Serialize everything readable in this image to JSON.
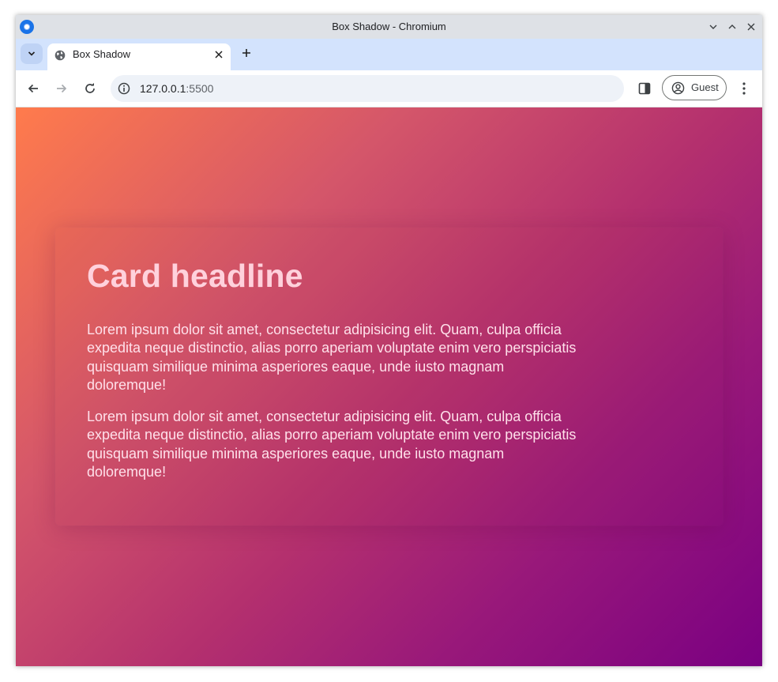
{
  "window": {
    "title": "Box Shadow - Chromium"
  },
  "tabs": [
    {
      "title": "Box Shadow",
      "active": true
    }
  ],
  "toolbar": {
    "url_host": "127.0.0.1",
    "url_port": ":5500",
    "profile_label": "Guest"
  },
  "page": {
    "card": {
      "headline": "Card headline",
      "paragraphs": [
        "Lorem ipsum dolor sit amet, consectetur adipisicing elit. Quam, culpa officia expedita neque distinctio, alias porro aperiam voluptate enim vero perspiciatis quisquam similique minima asperiores eaque, unde iusto magnam doloremque!",
        "Lorem ipsum dolor sit amet, consectetur adipisicing elit. Quam, culpa officia expedita neque distinctio, alias porro aperiam voluptate enim vero perspiciatis quisquam similique minima asperiores eaque, unde iusto magnam doloremque!"
      ]
    },
    "colors": {
      "gradient_start": "#ff7b4c",
      "gradient_end": "#7a0082",
      "headline_color": "#ffd1dc",
      "text_color": "#ffe0ea"
    }
  },
  "icons": {
    "app": "chromium-icon",
    "tab_search": "chevron-down-icon",
    "favicon": "globe-icon",
    "tab_close": "close-icon",
    "new_tab": "plus-icon",
    "back": "arrow-left-icon",
    "forward": "arrow-right-icon",
    "reload": "reload-icon",
    "site_info": "info-icon",
    "side_panel": "side-panel-icon",
    "profile": "account-circle-icon",
    "menu": "kebab-menu-icon",
    "minimize": "minimize-icon",
    "maximize": "maximize-icon",
    "close_window": "close-window-icon"
  }
}
